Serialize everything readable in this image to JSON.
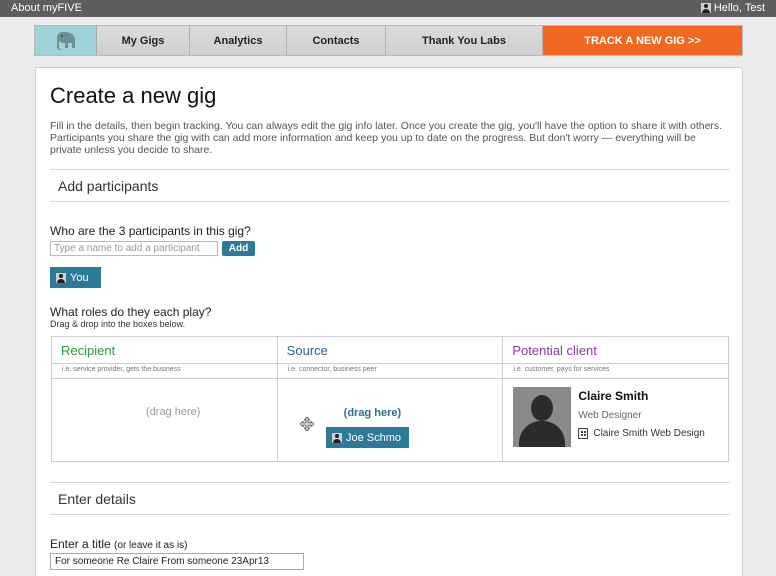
{
  "topbar": {
    "about": "About myFIVE",
    "greeting": "Hello, Test"
  },
  "nav": {
    "tabs": [
      "My Gigs",
      "Analytics",
      "Contacts",
      "Thank You Labs"
    ],
    "cta": "TRACK A NEW GIG >>"
  },
  "page": {
    "title": "Create a new gig",
    "intro": "Fill in the details, then begin tracking. You can always edit the gig info later. Once you create the gig, you'll have the option to share it with others. Participants you share the gig with can add more information and keep you up to date on the progress. But don't worry — everything will be private unless you decide to share."
  },
  "participants": {
    "section_title": "Add participants",
    "question": "Who are the 3 participants in this gig?",
    "input_placeholder": "Type a name to add a participant",
    "add_label": "Add",
    "you_chip": "You",
    "roles_question": "What roles do they each play?",
    "roles_hint": "Drag & drop into the boxes below."
  },
  "roles": [
    {
      "title": "Recipient",
      "desc": "i.e. service provider, gets the business",
      "drop": "(drag here)",
      "color": "#2c9a3c"
    },
    {
      "title": "Source",
      "desc": "i.e. connector, business peer",
      "drop": "(drag here)",
      "color": "#2a5f9e"
    },
    {
      "title": "Potential client",
      "desc": "i.e. customer, pays for services",
      "color": "#8a3b9a"
    }
  ],
  "dragging_chip": "Joe Schmo",
  "client": {
    "name": "Claire Smith",
    "role": "Web Designer",
    "company": "Claire Smith Web Design"
  },
  "details": {
    "section_title": "Enter details",
    "title_label": "Enter a title",
    "title_hint": "(or leave it as is)",
    "title_value": "For someone Re Claire From someone 23Apr13"
  },
  "colors": {
    "accent": "#2d7a98",
    "cta": "#f0681f",
    "logo_bg": "#9fd2d9"
  }
}
